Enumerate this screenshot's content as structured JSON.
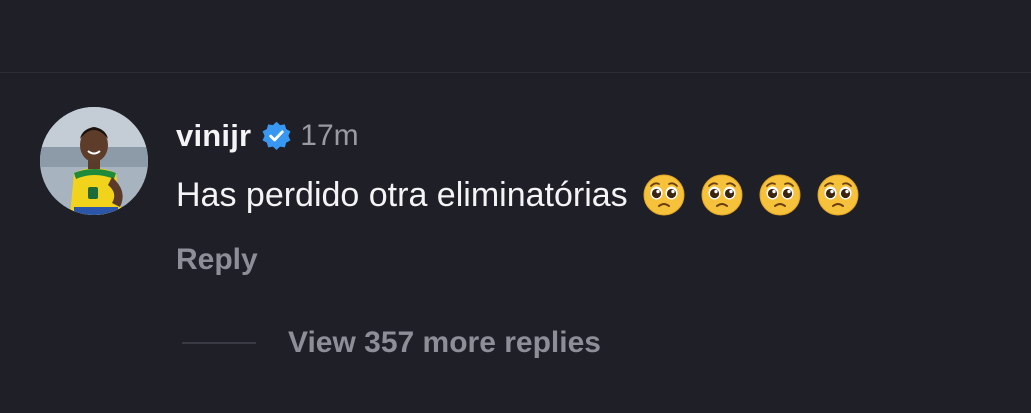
{
  "comment": {
    "username": "vinijr",
    "verified": true,
    "timestamp": "17m",
    "text": "Has perdido otra eliminatórias",
    "emoji_icons": [
      "pleading-face-icon",
      "pleading-face-icon",
      "pleading-face-icon",
      "pleading-face-icon"
    ],
    "reply_label": "Reply",
    "more_replies_label": "View 357 more replies"
  },
  "colors": {
    "background": "#1f1f27",
    "verified_badge": "#3897f0",
    "primary_text": "#f4f4f6",
    "secondary_text": "#8e8e98"
  }
}
